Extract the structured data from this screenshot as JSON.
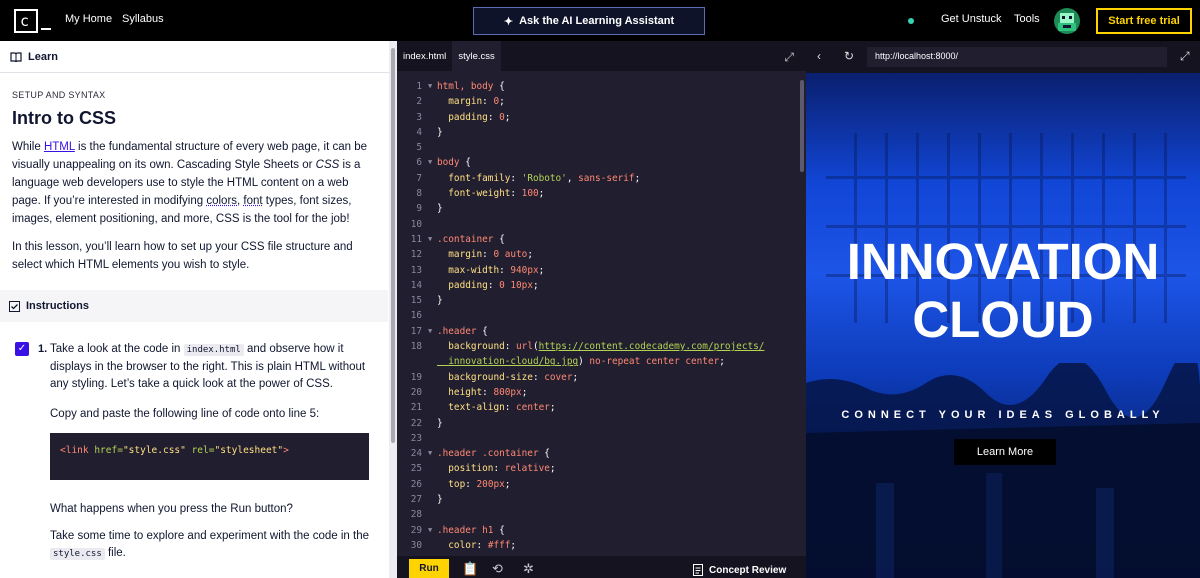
{
  "topbar": {
    "logo": "c",
    "nav": [
      "My Home",
      "Syllabus"
    ],
    "ai_button": "Ask the AI Learning Assistant",
    "get_unstuck": "Get Unstuck",
    "tools": "Tools",
    "trial": "Start free trial"
  },
  "learn": {
    "header": "Learn",
    "eyebrow": "SETUP AND SYNTAX",
    "title": "Intro to CSS",
    "p1_pre": "While ",
    "p1_link": "HTML",
    "p1_mid": " is the fundamental structure of every web page, it can be visually unappealing on its own. Cascading Style Sheets or ",
    "p1_css": "CSS",
    "p1_mid2": " is a language web developers use to style the HTML content on a web page. If you’re interested in modifying ",
    "p1_colors": "colors",
    "p1_comma": ", ",
    "p1_font": "font",
    "p1_end": " types, font sizes, images, element positioning, and more, CSS is the tool for the job!",
    "p2": "In this lesson, you’ll learn how to set up your CSS file structure and select which HTML elements you wish to style.",
    "instructions_label": "Instructions",
    "step_number": "1.",
    "step_pre": "Take a look at the code in ",
    "step_code": "index.html",
    "step_post": " and observe how it displays in the browser to the right. This is plain HTML without any styling. Let’s take a quick look at the power of CSS.",
    "copy_text": "Copy and paste the following line of code onto line 5:",
    "snippet_tag_open": "<link ",
    "snippet_attr1": "href=",
    "snippet_val1": "\"style.css\"",
    "snippet_attr2": " rel=",
    "snippet_val2": "\"stylesheet\"",
    "snippet_tag_close": ">",
    "run_question": "What happens when you press the Run button?",
    "explore_pre": "Take some time to explore and experiment with the code in the ",
    "explore_code": "style.css",
    "explore_post": " file."
  },
  "editor": {
    "tabs": [
      "index.html",
      "style.css"
    ],
    "active_tab": "style.css",
    "lines": [
      {
        "n": "1",
        "fold": true,
        "segs": [
          [
            "sel",
            "html, body "
          ],
          [
            "plain",
            "{"
          ]
        ]
      },
      {
        "n": "2",
        "fold": false,
        "segs": [
          [
            "prop",
            "  margin"
          ],
          [
            "plain",
            ": "
          ],
          [
            "num",
            "0"
          ],
          [
            "plain",
            ";"
          ]
        ]
      },
      {
        "n": "3",
        "fold": false,
        "segs": [
          [
            "prop",
            "  padding"
          ],
          [
            "plain",
            ": "
          ],
          [
            "num",
            "0"
          ],
          [
            "plain",
            ";"
          ]
        ]
      },
      {
        "n": "4",
        "fold": false,
        "segs": [
          [
            "plain",
            "}"
          ]
        ]
      },
      {
        "n": "5",
        "fold": false,
        "segs": []
      },
      {
        "n": "6",
        "fold": true,
        "segs": [
          [
            "sel",
            "body "
          ],
          [
            "plain",
            "{"
          ]
        ]
      },
      {
        "n": "7",
        "fold": false,
        "segs": [
          [
            "prop",
            "  font-family"
          ],
          [
            "plain",
            ": "
          ],
          [
            "str",
            "'Roboto'"
          ],
          [
            "plain",
            ", "
          ],
          [
            "kw",
            "sans-serif"
          ],
          [
            "plain",
            ";"
          ]
        ]
      },
      {
        "n": "8",
        "fold": false,
        "segs": [
          [
            "prop",
            "  font-weight"
          ],
          [
            "plain",
            ": "
          ],
          [
            "num",
            "100"
          ],
          [
            "plain",
            ";"
          ]
        ]
      },
      {
        "n": "9",
        "fold": false,
        "segs": [
          [
            "plain",
            "}"
          ]
        ]
      },
      {
        "n": "10",
        "fold": false,
        "segs": []
      },
      {
        "n": "11",
        "fold": true,
        "segs": [
          [
            "sel",
            ".container "
          ],
          [
            "plain",
            "{"
          ]
        ]
      },
      {
        "n": "12",
        "fold": false,
        "segs": [
          [
            "prop",
            "  margin"
          ],
          [
            "plain",
            ": "
          ],
          [
            "num",
            "0"
          ],
          [
            "kw",
            " auto"
          ],
          [
            "plain",
            ";"
          ]
        ]
      },
      {
        "n": "13",
        "fold": false,
        "segs": [
          [
            "prop",
            "  max-width"
          ],
          [
            "plain",
            ": "
          ],
          [
            "num",
            "940px"
          ],
          [
            "plain",
            ";"
          ]
        ]
      },
      {
        "n": "14",
        "fold": false,
        "segs": [
          [
            "prop",
            "  padding"
          ],
          [
            "plain",
            ": "
          ],
          [
            "num",
            "0 10px"
          ],
          [
            "plain",
            ";"
          ]
        ]
      },
      {
        "n": "15",
        "fold": false,
        "segs": [
          [
            "plain",
            "}"
          ]
        ]
      },
      {
        "n": "16",
        "fold": false,
        "segs": []
      },
      {
        "n": "17",
        "fold": true,
        "segs": [
          [
            "sel",
            ".header "
          ],
          [
            "plain",
            "{"
          ]
        ]
      },
      {
        "n": "18",
        "fold": false,
        "segs": [
          [
            "prop",
            "  background"
          ],
          [
            "plain",
            ": "
          ],
          [
            "kw",
            "url"
          ],
          [
            "plain",
            "("
          ],
          [
            "url",
            "https://content.codecademy.com/projects/"
          ]
        ]
      },
      {
        "n": "",
        "fold": false,
        "segs": [
          [
            "url",
            "  innovation-cloud/bg.jpg"
          ],
          [
            "plain",
            ")"
          ],
          [
            "kw",
            " no-repeat center center"
          ],
          [
            "plain",
            ";"
          ]
        ]
      },
      {
        "n": "19",
        "fold": false,
        "segs": [
          [
            "prop",
            "  background-size"
          ],
          [
            "plain",
            ": "
          ],
          [
            "kw",
            "cover"
          ],
          [
            "plain",
            ";"
          ]
        ]
      },
      {
        "n": "20",
        "fold": false,
        "segs": [
          [
            "prop",
            "  height"
          ],
          [
            "plain",
            ": "
          ],
          [
            "num",
            "800px"
          ],
          [
            "plain",
            ";"
          ]
        ]
      },
      {
        "n": "21",
        "fold": false,
        "segs": [
          [
            "prop",
            "  text-align"
          ],
          [
            "plain",
            ": "
          ],
          [
            "kw",
            "center"
          ],
          [
            "plain",
            ";"
          ]
        ]
      },
      {
        "n": "22",
        "fold": false,
        "segs": [
          [
            "plain",
            "}"
          ]
        ]
      },
      {
        "n": "23",
        "fold": false,
        "segs": []
      },
      {
        "n": "24",
        "fold": true,
        "segs": [
          [
            "sel",
            ".header .container "
          ],
          [
            "plain",
            "{"
          ]
        ]
      },
      {
        "n": "25",
        "fold": false,
        "segs": [
          [
            "prop",
            "  position"
          ],
          [
            "plain",
            ": "
          ],
          [
            "kw",
            "relative"
          ],
          [
            "plain",
            ";"
          ]
        ]
      },
      {
        "n": "26",
        "fold": false,
        "segs": [
          [
            "prop",
            "  top"
          ],
          [
            "plain",
            ": "
          ],
          [
            "num",
            "200px"
          ],
          [
            "plain",
            ";"
          ]
        ]
      },
      {
        "n": "27",
        "fold": false,
        "segs": [
          [
            "plain",
            "}"
          ]
        ]
      },
      {
        "n": "28",
        "fold": false,
        "segs": []
      },
      {
        "n": "29",
        "fold": true,
        "segs": [
          [
            "sel",
            ".header h1 "
          ],
          [
            "plain",
            "{"
          ]
        ]
      },
      {
        "n": "30",
        "fold": false,
        "segs": [
          [
            "prop",
            "  color"
          ],
          [
            "plain",
            ": "
          ],
          [
            "num",
            "#fff"
          ],
          [
            "plain",
            ";"
          ]
        ]
      }
    ],
    "run_label": "Run",
    "concept_review": "Concept Review"
  },
  "browser": {
    "url": "http://localhost:8000/",
    "hero_line1": "INNOVATION",
    "hero_line2": "CLOUD",
    "tagline": "CONNECT YOUR IDEAS GLOBALLY",
    "learn_more": "Learn More"
  },
  "colors": {
    "accent_yellow": "#ffd300",
    "link_purple": "#3a10e5",
    "editor_bg": "#211e2f",
    "hero_blue": "#1d55e8"
  }
}
